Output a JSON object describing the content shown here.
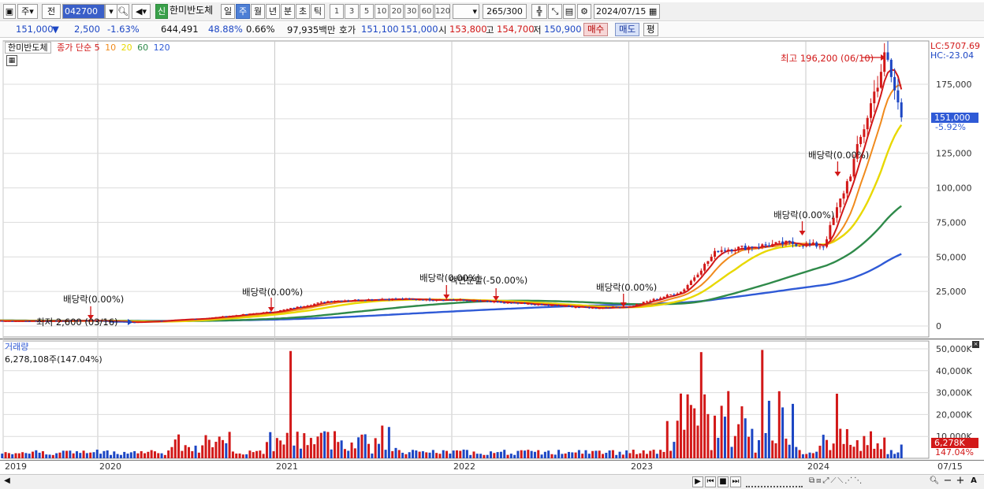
{
  "toolbar": {
    "market_type": "주",
    "prev_label": "전",
    "stock_code": "042700",
    "shin_label": "신",
    "stock_name": "한미반도체",
    "period_tabs": [
      "일",
      "주",
      "월",
      "년",
      "분",
      "초",
      "틱"
    ],
    "active_period": "주",
    "interval_buttons": [
      "1",
      "3",
      "5",
      "10",
      "20",
      "30",
      "60",
      "120"
    ],
    "count_value": "265",
    "count_total": "/300",
    "date_value": "2024/07/15"
  },
  "quote": {
    "price": "151,000",
    "down_arrow": "▼",
    "change": "2,500",
    "change_pct": "-1.63%",
    "volume": "644,491",
    "volume_ratio": "48.88%",
    "turnover_pct": "0.66%",
    "trade_value": "97,935백만",
    "hoga_label": "호가",
    "ask": "151,100",
    "bid": "151,000",
    "open_label": "시",
    "open": "153,800",
    "high_label": "고",
    "high": "154,700",
    "low_label": "저",
    "low": "150,900",
    "buy_label": "매수",
    "sell_label": "매도",
    "pyeong_label": "평"
  },
  "legend": {
    "stock_name": "한미반도체",
    "ma_title": "종가 단순",
    "ma_periods": [
      {
        "label": "5",
        "color": "#d21818"
      },
      {
        "label": "10",
        "color": "#f08a1c"
      },
      {
        "label": "20",
        "color": "#e8d800"
      },
      {
        "label": "60",
        "color": "#2f8a4a"
      },
      {
        "label": "120",
        "color": "#2f5ad6"
      }
    ],
    "volume_title": "거래량",
    "volume_value": "6,278,108주(147.04%)"
  },
  "annotations": {
    "lc": "LC:5707.69",
    "hc": "HC:-23.04",
    "max_label": "최고 196,200 (06/10)",
    "min_label": "최저 2,600 (03/16)",
    "dividends": [
      "배당락(0.00%)",
      "배당락(0.00%)",
      "배당락(0.00%)",
      "액면분할(-50.00%)",
      "배당락(0.00%)",
      "배당락(0.00%)",
      "배당락(0.00%)"
    ],
    "current_price_tag": "151,000",
    "current_pct_tag": "-5.92%",
    "vol_tag": "6,278K",
    "vol_pct_tag": "147.04%"
  },
  "axes": {
    "price_ticks": [
      "175,000",
      "150,000",
      "125,000",
      "100,000",
      "75,000",
      "50,000",
      "25,000",
      "0"
    ],
    "volume_ticks": [
      "50,000K",
      "40,000K",
      "30,000K",
      "20,000K",
      "10,000K"
    ],
    "year_ticks": [
      "2019",
      "2020",
      "2021",
      "2022",
      "2023",
      "2024",
      "07/15"
    ]
  },
  "colors": {
    "up": "#d21818",
    "down": "#1c46c4",
    "ma5": "#d21818",
    "ma10": "#f08a1c",
    "ma20": "#e8d800",
    "ma60": "#2f8a4a",
    "ma120": "#2f5ad6"
  },
  "chart_data": {
    "type": "candlestick",
    "frequency": "weekly",
    "x_labels": [
      "2019",
      "2020",
      "2021",
      "2022",
      "2023",
      "2024"
    ],
    "price_ylim": [
      0,
      196200
    ],
    "volume_ylim_k": [
      0,
      52000
    ],
    "key_points": {
      "high": {
        "value": 196200,
        "date": "06/10"
      },
      "low": {
        "value": 2600,
        "date": "03/16"
      },
      "last_close": 151000
    },
    "close_trend": [
      {
        "x": 2019.0,
        "close": 4500
      },
      {
        "x": 2019.5,
        "close": 3500
      },
      {
        "x": 2020.0,
        "close": 3800
      },
      {
        "x": 2020.2,
        "close": 2600
      },
      {
        "x": 2020.6,
        "close": 5500
      },
      {
        "x": 2021.0,
        "close": 10500
      },
      {
        "x": 2021.3,
        "close": 18000
      },
      {
        "x": 2021.6,
        "close": 19500
      },
      {
        "x": 2022.0,
        "close": 19000
      },
      {
        "x": 2022.4,
        "close": 16000
      },
      {
        "x": 2022.8,
        "close": 13000
      },
      {
        "x": 2023.0,
        "close": 14000
      },
      {
        "x": 2023.3,
        "close": 25000
      },
      {
        "x": 2023.5,
        "close": 55000
      },
      {
        "x": 2023.9,
        "close": 60000
      },
      {
        "x": 2024.1,
        "close": 58000
      },
      {
        "x": 2024.25,
        "close": 110000
      },
      {
        "x": 2024.45,
        "close": 196200
      },
      {
        "x": 2024.54,
        "close": 151000
      }
    ]
  }
}
